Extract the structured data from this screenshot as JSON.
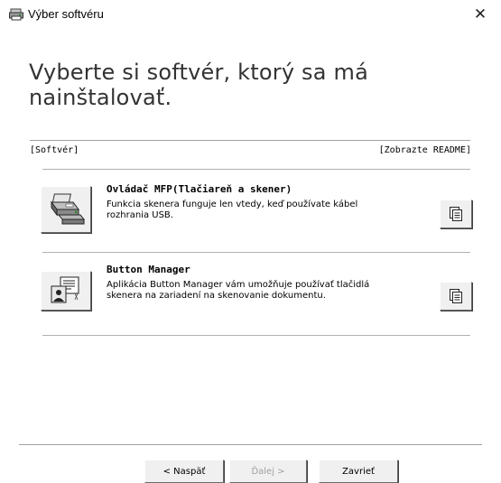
{
  "window": {
    "title": "Výber softvéru",
    "close_glyph": "✕"
  },
  "heading": "Vyberte si softvér, ktorý sa má nainštalovať.",
  "columns": {
    "software": "[Softvér]",
    "readme": "[Zobrazte README]"
  },
  "software": [
    {
      "name": "Ovládač MFP(Tlačiareň a skener)",
      "desc_lines": [
        "Funkcia skenera funguje len vtedy, keď používate kábel",
        "rozhrania USB."
      ],
      "icon": "printer-scanner-icon",
      "readme_icon": "readme-document-icon"
    },
    {
      "name": "Button Manager",
      "desc_lines": [
        "Aplikácia Button Manager vám umožňuje používať tlačidlá",
        "skenera na zariadení na skenovanie dokumentu."
      ],
      "icon": "button-manager-icon",
      "readme_icon": "readme-document-icon"
    }
  ],
  "buttons": {
    "back": "< Naspäť",
    "next": "Ďalej >",
    "close": "Zavrieť"
  },
  "colors": {
    "window_bg": "#ffffff",
    "button_face": "#f0f0f0",
    "disabled_text": "#a0a0a0"
  }
}
